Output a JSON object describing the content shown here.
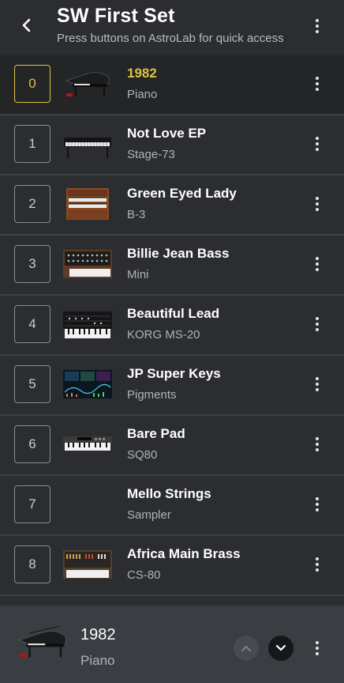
{
  "header": {
    "title": "SW First Set",
    "subtitle": "Press buttons on AstroLab for quick access"
  },
  "presets": [
    {
      "number": "0",
      "name": "1982",
      "instrument": "Piano",
      "icon": "grand-piano-icon",
      "active": true
    },
    {
      "number": "1",
      "name": "Not Love EP",
      "instrument": "Stage-73",
      "icon": "electric-piano-icon",
      "active": false
    },
    {
      "number": "2",
      "name": "Green Eyed Lady",
      "instrument": "B-3",
      "icon": "organ-icon",
      "active": false
    },
    {
      "number": "3",
      "name": "Billie Jean Bass",
      "instrument": "Mini",
      "icon": "synth-mini-icon",
      "active": false
    },
    {
      "number": "4",
      "name": "Beautiful Lead",
      "instrument": "KORG MS-20",
      "icon": "synth-ms20-icon",
      "active": false
    },
    {
      "number": "5",
      "name": "JP Super Keys",
      "instrument": "Pigments",
      "icon": "pigments-icon",
      "active": false
    },
    {
      "number": "6",
      "name": "Bare Pad",
      "instrument": "SQ80",
      "icon": "synth-sq80-icon",
      "active": false
    },
    {
      "number": "7",
      "name": "Mello Strings",
      "instrument": "Sampler",
      "icon": "waveform-icon",
      "active": false
    },
    {
      "number": "8",
      "name": "Africa Main Brass",
      "instrument": "CS-80",
      "icon": "synth-cs80-icon",
      "active": false
    }
  ],
  "footer": {
    "name": "1982",
    "instrument": "Piano"
  },
  "colors": {
    "accent": "#e0c341",
    "background": "#2b2d30",
    "footer_bg": "#3a3d41"
  }
}
